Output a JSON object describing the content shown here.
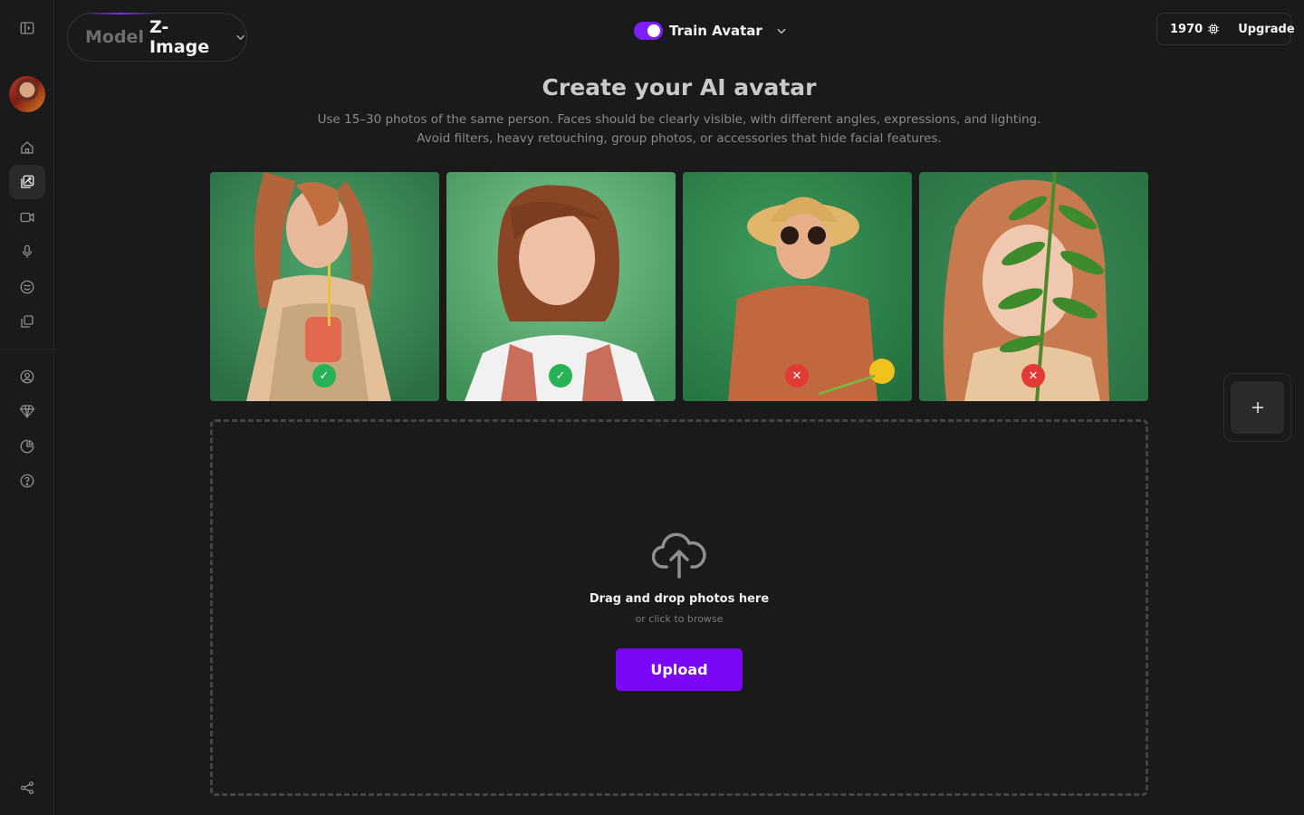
{
  "toolbar": {
    "model_label": "Model",
    "model_name": "Z-Image",
    "train_label": "Train Avatar",
    "credits": "1970",
    "upgrade_label": "Upgrade"
  },
  "header": {
    "title": "Create your AI avatar",
    "subtitle_line1": "Use 15–30 photos of the same person. Faces should be clearly visible, with different angles, expressions, and lighting.",
    "subtitle_line2": "Avoid filters, heavy retouching, group photos, or accessories that hide facial features."
  },
  "photos": [
    {
      "status": "approved",
      "mark": "✓"
    },
    {
      "status": "approved",
      "mark": "✓"
    },
    {
      "status": "rejected",
      "mark": "✕"
    },
    {
      "status": "rejected",
      "mark": "✕"
    }
  ],
  "dropzone": {
    "title": "Drag and drop photos here",
    "hint": "or click to browse",
    "upload_label": "Upload"
  },
  "colors": {
    "accent": "#7a07f5",
    "approved": "#27b355",
    "rejected": "#e23a35",
    "background": "#1a1a1a"
  },
  "icons": {
    "sidebar": [
      "sidebar-toggle-icon",
      "home-icon",
      "image-gallery-icon",
      "video-icon",
      "microphone-icon",
      "emoji-icon",
      "copy-icon",
      "user-icon",
      "diamond-icon",
      "pie-chart-icon",
      "help-icon",
      "share-icon"
    ],
    "credits": "chip-icon",
    "upload": "cloud-upload-icon",
    "add": "plus-icon"
  }
}
